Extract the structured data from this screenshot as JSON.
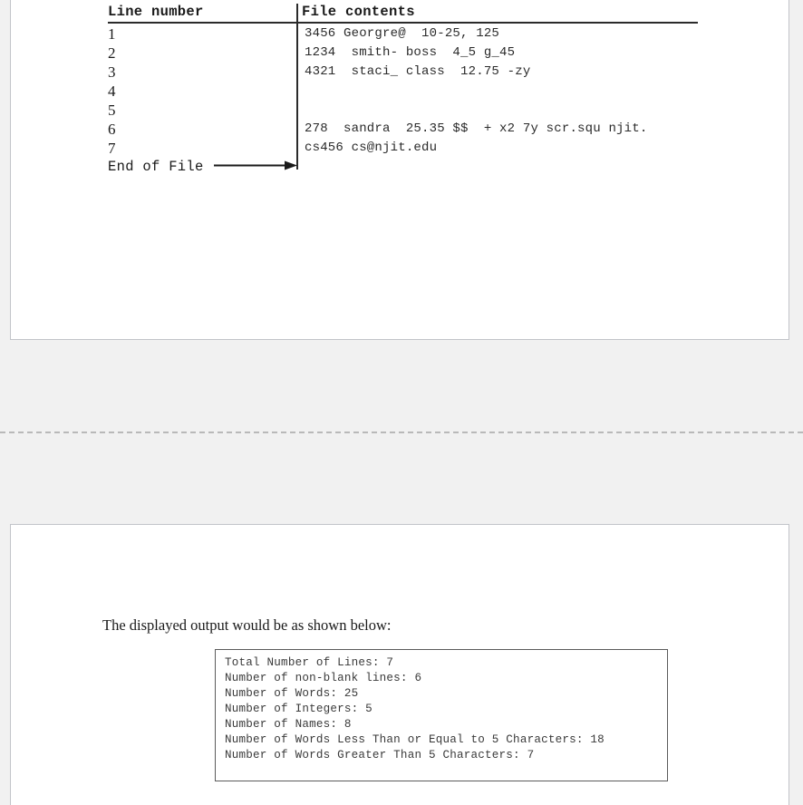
{
  "document": {
    "page_background": "#f1f1f1",
    "panel_background": "#ffffff",
    "panel_border_color": "#c2c4c9"
  },
  "file_table": {
    "headers": {
      "line_number": "Line number",
      "file_contents": "File contents"
    },
    "rows": [
      {
        "line": "1",
        "content": "3456 Georgre@  10-25, 125"
      },
      {
        "line": "2",
        "content": "1234  smith- boss  4_5 g_45"
      },
      {
        "line": "3",
        "content": "4321  staci_ class  12.75 -zy"
      },
      {
        "line": "4",
        "content": ""
      },
      {
        "line": "5",
        "content": ""
      },
      {
        "line": "6",
        "content": "278  sandra  25.35 $$  + x2 7y scr.squ njit."
      },
      {
        "line": "7",
        "content": "cs456 cs@njit.edu"
      }
    ],
    "eof_label": "End of File"
  },
  "output_section": {
    "caption": "The displayed output would be as shown below:",
    "lines": [
      "Total Number of Lines: 7",
      "Number of non-blank lines: 6",
      "Number of Words: 25",
      "Number of Integers: 5",
      "Number of Names: 8",
      "Number of Words Less Than or Equal to 5 Characters: 18",
      "Number of Words Greater Than 5 Characters: 7"
    ]
  }
}
